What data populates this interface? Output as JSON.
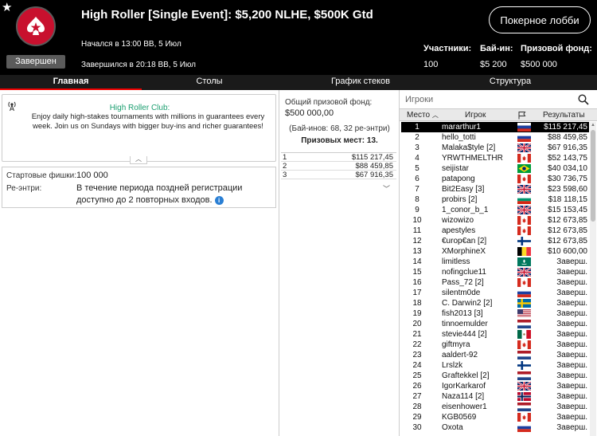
{
  "header": {
    "title": "High Roller [Single Event]: $5,200 NLHE, $500K Gtd",
    "status_badge": "Завершен",
    "started": "Начался в 13:00 ВВ, 5 Июл",
    "ended": "Завершился в 20:18 ВВ, 5 Июл",
    "lobby_button": "Покерное лобби",
    "stats": [
      {
        "label": "Участники:",
        "value": "100"
      },
      {
        "label": "Бай-ин:",
        "value": "$5 200"
      },
      {
        "label": "Призовой фонд:",
        "value": "$500 000"
      }
    ]
  },
  "tabs": [
    {
      "label": "Главная",
      "active": true
    },
    {
      "label": "Столы",
      "active": false
    },
    {
      "label": "График стеков",
      "active": false
    },
    {
      "label": "Структура",
      "active": false
    }
  ],
  "promo": {
    "title": "High Roller Club:",
    "text": "Enjoy daily high-stakes tournaments with millions in guarantees every week. Join us on Sundays with bigger buy-ins and richer guarantees!"
  },
  "details": {
    "starting_chips_label": "Стартовые фишки:",
    "starting_chips_value": "100 000",
    "reentry_label": "Ре-энтри:",
    "reentry_value_line1": "В течение периода поздней регистрации",
    "reentry_value_line2": "доступно до 2 повторных входов."
  },
  "prizepool": {
    "label": "Общий призовой фонд:",
    "value": "$500 000,00",
    "buyins": "(Бай-инов: 68, 32 ре-энтри)",
    "paid_places": "Призовых мест: 13.",
    "payouts": [
      {
        "place": "1",
        "amount": "$115 217,45"
      },
      {
        "place": "2",
        "amount": "$88 459,85"
      },
      {
        "place": "3",
        "amount": "$67 916,35"
      }
    ]
  },
  "players": {
    "search_placeholder": "Игроки",
    "columns": {
      "place": "Место",
      "player": "Игрок",
      "results": "Результаты"
    },
    "rows": [
      {
        "place": "1",
        "name": "mararthur1",
        "flag": "ru",
        "result": "$115 217,45",
        "selected": true
      },
      {
        "place": "2",
        "name": "hello_totti",
        "flag": "ru",
        "result": "$88 459,85"
      },
      {
        "place": "3",
        "name": "Malaka$tyle [2]",
        "flag": "gb",
        "result": "$67 916,35"
      },
      {
        "place": "4",
        "name": "YRWTHMELTHR",
        "flag": "ca",
        "result": "$52 143,75"
      },
      {
        "place": "5",
        "name": "seijistar",
        "flag": "br",
        "result": "$40 034,10"
      },
      {
        "place": "6",
        "name": "patapong",
        "flag": "ca",
        "result": "$30 736,75"
      },
      {
        "place": "7",
        "name": "Bit2Easy [3]",
        "flag": "gb",
        "result": "$23 598,60"
      },
      {
        "place": "8",
        "name": "probirs [2]",
        "flag": "bg",
        "result": "$18 118,15"
      },
      {
        "place": "9",
        "name": "1_conor_b_1",
        "flag": "gb",
        "result": "$15 153,45"
      },
      {
        "place": "10",
        "name": "wizowizo",
        "flag": "ca",
        "result": "$12 673,85"
      },
      {
        "place": "11",
        "name": "apestyles",
        "flag": "ca",
        "result": "$12 673,85"
      },
      {
        "place": "12",
        "name": "€urop€an [2]",
        "flag": "fi",
        "result": "$12 673,85"
      },
      {
        "place": "13",
        "name": "XMorphineX",
        "flag": "be",
        "result": "$10 600,00"
      },
      {
        "place": "14",
        "name": "limitless",
        "flag": "mo",
        "result": "Заверш."
      },
      {
        "place": "15",
        "name": "nofingclue11",
        "flag": "gb",
        "result": "Заверш."
      },
      {
        "place": "16",
        "name": "Pass_72 [2]",
        "flag": "ca",
        "result": "Заверш."
      },
      {
        "place": "17",
        "name": "silentm0de",
        "flag": "ru",
        "result": "Заверш."
      },
      {
        "place": "18",
        "name": "C. Darwin2 [2]",
        "flag": "se",
        "result": "Заверш."
      },
      {
        "place": "19",
        "name": "fish2013 [3]",
        "flag": "us",
        "result": "Заверш."
      },
      {
        "place": "20",
        "name": "tinnoemulder",
        "flag": "nl",
        "result": "Заверш."
      },
      {
        "place": "21",
        "name": "stevie444 [2]",
        "flag": "mx",
        "result": "Заверш."
      },
      {
        "place": "22",
        "name": "giftmyra",
        "flag": "ca",
        "result": "Заверш."
      },
      {
        "place": "23",
        "name": "aaldert-92",
        "flag": "nl",
        "result": "Заверш."
      },
      {
        "place": "24",
        "name": "Lrslzk",
        "flag": "fi",
        "result": "Заверш."
      },
      {
        "place": "25",
        "name": "Graftekkel [2]",
        "flag": "nl",
        "result": "Заверш."
      },
      {
        "place": "26",
        "name": "IgorKarkarof",
        "flag": "gb",
        "result": "Заверш."
      },
      {
        "place": "27",
        "name": "Naza114 [2]",
        "flag": "no",
        "result": "Заверш."
      },
      {
        "place": "28",
        "name": "eisenhower1",
        "flag": "nl",
        "result": "Заверш."
      },
      {
        "place": "29",
        "name": "KGB0569",
        "flag": "ca",
        "result": "Заверш."
      },
      {
        "place": "30",
        "name": "Oxota",
        "flag": "ru",
        "result": "Заверш."
      }
    ]
  }
}
